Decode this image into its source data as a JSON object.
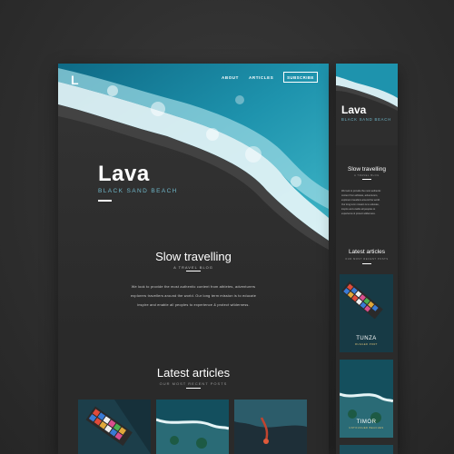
{
  "desktop": {
    "logo": "L",
    "nav": {
      "about": "ABOUT",
      "articles": "ARTICLES",
      "subscribe": "SUBSCRIBE"
    },
    "hero": {
      "title": "Lava",
      "subtitle": "BLACK SAND BEACH"
    },
    "intro": {
      "title": "Slow travelling",
      "subtitle": "A TRAVEL BLOG",
      "body": [
        "We look to provide the most authentic content from athletes, adventurers",
        "explorers travellers around the world. Our long term mission is to educate",
        "inspire and enable all peoples to experience & protect wilderness."
      ]
    },
    "latest": {
      "title": "Latest articles",
      "subtitle": "OUR MOST RECENT POSTS"
    }
  },
  "mobile": {
    "hero": {
      "title": "Lava",
      "subtitle": "BLACK SAND BEACH"
    },
    "intro": {
      "title": "Slow travelling",
      "subtitle": "A TRAVEL BLOG",
      "body": [
        "We look to provide the most authentic",
        "content from athletes, adventurers,",
        "explorers travellers around the world.",
        "Our long term mission is to educate,",
        "inspire and enable all peoples to",
        "experience & protect wilderness."
      ]
    },
    "latest": {
      "title": "Latest articles",
      "subtitle": "OUR MOST RECENT POSTS"
    },
    "cards": [
      {
        "title": "TUNZA",
        "subtitle": "RUGGED PORT"
      },
      {
        "title": "TIMOR",
        "subtitle": "UNTOUCHED BEACHES"
      }
    ]
  },
  "colors": {
    "accent": "#6fb6c8",
    "ocean": "#1f8aa2",
    "sand": "#2e2e2e",
    "foam": "#ffffff",
    "card_accent": "#e3c77a"
  }
}
